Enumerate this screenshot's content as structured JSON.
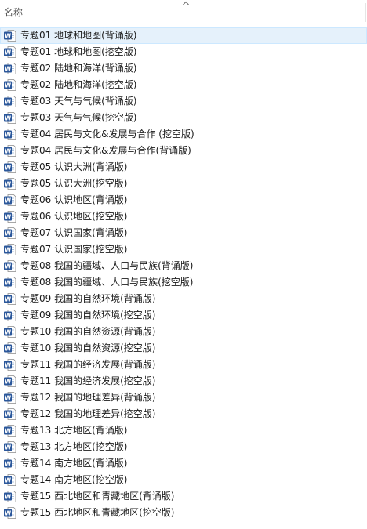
{
  "header": {
    "column_title": "名称",
    "sort_icon": "chevron-up-icon"
  },
  "file_icon": "word-document-icon",
  "colors": {
    "selected_bg": "#e5f1fb",
    "word_blue": "#2b579a"
  },
  "selected_index": 0,
  "files": [
    "专题01 地球和地图(背诵版)",
    "专题01 地球和地图(挖空版)",
    "专题02 陆地和海洋(背诵版)",
    "专题02 陆地和海洋(挖空版)",
    "专题03 天气与气候(背诵版)",
    "专题03 天气与气候(挖空版)",
    "专题04 居民与文化&发展与合作 (挖空版)",
    "专题04 居民与文化&发展与合作(背诵版)",
    "专题05 认识大洲(背诵版)",
    "专题05 认识大洲(挖空版)",
    "专题06  认识地区(背诵版)",
    "专题06  认识地区(挖空版)",
    "专题07  认识国家(背诵版)",
    "专题07  认识国家(挖空版)",
    "专题08  我国的疆域、人口与民族(背诵版)",
    "专题08  我国的疆域、人口与民族(挖空版)",
    "专题09  我国的自然环境(背诵版)",
    "专题09  我国的自然环境(挖空版)",
    "专题10  我国的自然资源(背诵版)",
    "专题10  我国的自然资源(挖空版)",
    "专题11  我国的经济发展(背诵版)",
    "专题11  我国的经济发展(挖空版)",
    "专题12  我国的地理差异(背诵版)",
    "专题12  我国的地理差异(挖空版)",
    "专题13  北方地区(背诵版)",
    "专题13  北方地区(挖空版)",
    "专题14  南方地区(背诵版)",
    "专题14  南方地区(挖空版)",
    "专题15  西北地区和青藏地区(背诵版)",
    "专题15  西北地区和青藏地区(挖空版)"
  ]
}
